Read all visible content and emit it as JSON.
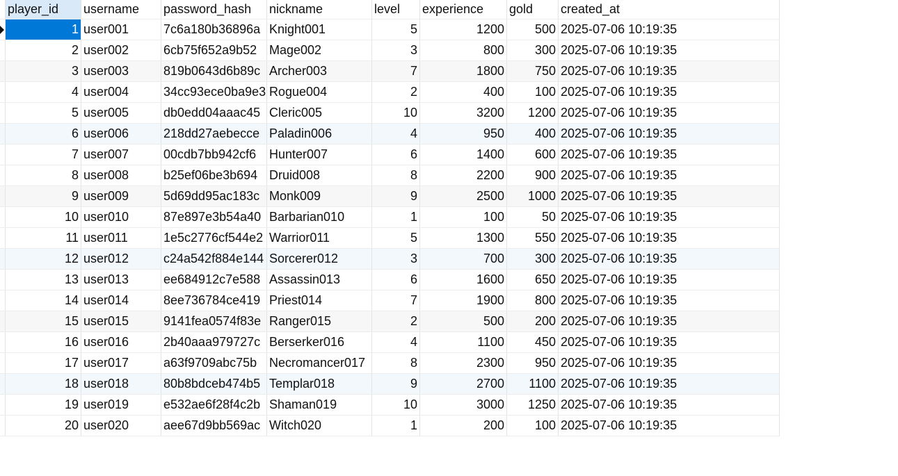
{
  "columns": [
    "player_id",
    "username",
    "password_hash",
    "nickname",
    "level",
    "experience",
    "gold",
    "created_at"
  ],
  "rows": [
    [
      "1",
      "user001",
      "7c6a180b36896a",
      "Knight001",
      "5",
      "1200",
      "500",
      "2025-07-06 10:19:35"
    ],
    [
      "2",
      "user002",
      "6cb75f652a9b52",
      "Mage002",
      "3",
      "800",
      "300",
      "2025-07-06 10:19:35"
    ],
    [
      "3",
      "user003",
      "819b0643d6b89c",
      "Archer003",
      "7",
      "1800",
      "750",
      "2025-07-06 10:19:35"
    ],
    [
      "4",
      "user004",
      "34cc93ece0ba9e3",
      "Rogue004",
      "2",
      "400",
      "100",
      "2025-07-06 10:19:35"
    ],
    [
      "5",
      "user005",
      "db0edd04aaac45",
      "Cleric005",
      "10",
      "3200",
      "1200",
      "2025-07-06 10:19:35"
    ],
    [
      "6",
      "user006",
      "218dd27aebecce",
      "Paladin006",
      "4",
      "950",
      "400",
      "2025-07-06 10:19:35"
    ],
    [
      "7",
      "user007",
      "00cdb7bb942cf6",
      "Hunter007",
      "6",
      "1400",
      "600",
      "2025-07-06 10:19:35"
    ],
    [
      "8",
      "user008",
      "b25ef06be3b694",
      "Druid008",
      "8",
      "2200",
      "900",
      "2025-07-06 10:19:35"
    ],
    [
      "9",
      "user009",
      "5d69dd95ac183c",
      "Monk009",
      "9",
      "2500",
      "1000",
      "2025-07-06 10:19:35"
    ],
    [
      "10",
      "user010",
      "87e897e3b54a40",
      "Barbarian010",
      "1",
      "100",
      "50",
      "2025-07-06 10:19:35"
    ],
    [
      "11",
      "user011",
      "1e5c2776cf544e2",
      "Warrior011",
      "5",
      "1300",
      "550",
      "2025-07-06 10:19:35"
    ],
    [
      "12",
      "user012",
      "c24a542f884e144",
      "Sorcerer012",
      "3",
      "700",
      "300",
      "2025-07-06 10:19:35"
    ],
    [
      "13",
      "user013",
      "ee684912c7e588",
      "Assassin013",
      "6",
      "1600",
      "650",
      "2025-07-06 10:19:35"
    ],
    [
      "14",
      "user014",
      "8ee736784ce419",
      "Priest014",
      "7",
      "1900",
      "800",
      "2025-07-06 10:19:35"
    ],
    [
      "15",
      "user015",
      "9141fea0574f83e",
      "Ranger015",
      "2",
      "500",
      "200",
      "2025-07-06 10:19:35"
    ],
    [
      "16",
      "user016",
      "2b40aaa979727c",
      "Berserker016",
      "4",
      "1100",
      "450",
      "2025-07-06 10:19:35"
    ],
    [
      "17",
      "user017",
      "a63f9709abc75b",
      "Necromancer017",
      "8",
      "2300",
      "950",
      "2025-07-06 10:19:35"
    ],
    [
      "18",
      "user018",
      "80b8bdceb474b5",
      "Templar018",
      "9",
      "2700",
      "1100",
      "2025-07-06 10:19:35"
    ],
    [
      "19",
      "user019",
      "e532ae6f28f4c2b",
      "Shaman019",
      "10",
      "3000",
      "1250",
      "2025-07-06 10:19:35"
    ],
    [
      "20",
      "user020",
      "aee67d9bb569ac",
      "Witch020",
      "1",
      "200",
      "100",
      "2025-07-06 10:19:35"
    ]
  ],
  "colors": {
    "selection": "#0078d7",
    "header_selected": "#d9e9f8"
  }
}
